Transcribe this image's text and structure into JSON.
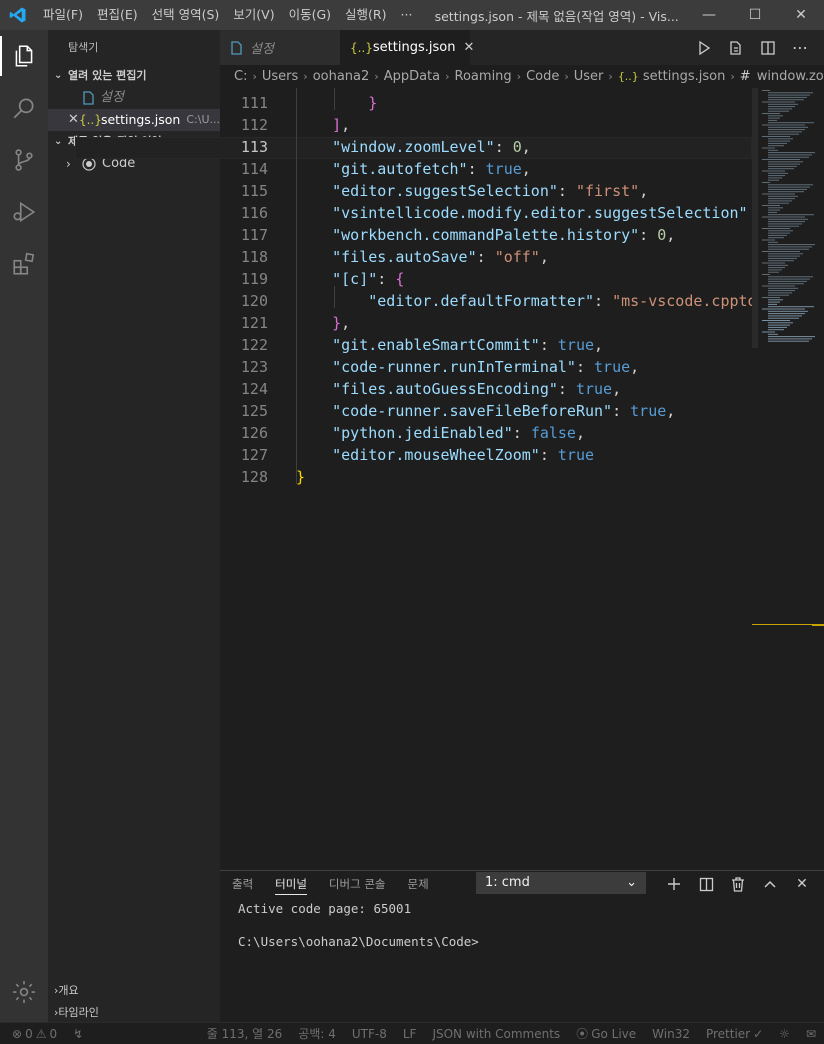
{
  "titlebar": {
    "menu": [
      "파일(F)",
      "편집(E)",
      "선택 영역(S)",
      "보기(V)",
      "이동(G)",
      "실행(R)",
      "···"
    ],
    "window_title": "settings.json - 제목 없음(작업 영역) - Vis..."
  },
  "sidebar": {
    "title": "탐색기",
    "open_editors_label": "열려 있는 편집기",
    "open_editors": [
      {
        "name": "설정",
        "icon": "file-icon"
      },
      {
        "name": "settings.json",
        "path": "C:\\U...",
        "icon": "json-braces-icon"
      }
    ],
    "workspace_label": "제목 없음(작업 영역)",
    "workspace_folder": "Code",
    "outline_label": "개요",
    "timeline_label": "타임라인"
  },
  "tabs": [
    {
      "label": "설정",
      "active": false
    },
    {
      "label": "settings.json",
      "active": true
    }
  ],
  "breadcrumb": [
    "C:",
    "Users",
    "oohana2",
    "AppData",
    "Roaming",
    "Code",
    "User",
    "settings.json",
    "window.zoomLev..."
  ],
  "editor": {
    "current_line": 113,
    "lines": [
      {
        "n": "111",
        "tokens": [
          {
            "t": "        ",
            "c": "p"
          },
          {
            "t": "}",
            "c": "bracket2"
          }
        ]
      },
      {
        "n": "112",
        "tokens": [
          {
            "t": "    ",
            "c": "p"
          },
          {
            "t": "]",
            "c": "bracket2"
          },
          {
            "t": ",",
            "c": "p"
          }
        ]
      },
      {
        "n": "113",
        "tokens": [
          {
            "t": "    ",
            "c": "p"
          },
          {
            "t": "\"window.zoomLevel\"",
            "c": "k"
          },
          {
            "t": ": ",
            "c": "p"
          },
          {
            "t": "0",
            "c": "n"
          },
          {
            "t": ",",
            "c": "p"
          }
        ]
      },
      {
        "n": "114",
        "tokens": [
          {
            "t": "    ",
            "c": "p"
          },
          {
            "t": "\"git.autofetch\"",
            "c": "k"
          },
          {
            "t": ": ",
            "c": "p"
          },
          {
            "t": "true",
            "c": "b"
          },
          {
            "t": ",",
            "c": "p"
          }
        ]
      },
      {
        "n": "115",
        "tokens": [
          {
            "t": "    ",
            "c": "p"
          },
          {
            "t": "\"editor.suggestSelection\"",
            "c": "k"
          },
          {
            "t": ": ",
            "c": "p"
          },
          {
            "t": "\"first\"",
            "c": "s"
          },
          {
            "t": ",",
            "c": "p"
          }
        ]
      },
      {
        "n": "116",
        "tokens": [
          {
            "t": "    ",
            "c": "p"
          },
          {
            "t": "\"vsintellicode.modify.editor.suggestSelection\"",
            "c": "k"
          }
        ]
      },
      {
        "n": "117",
        "tokens": [
          {
            "t": "    ",
            "c": "p"
          },
          {
            "t": "\"workbench.commandPalette.history\"",
            "c": "k"
          },
          {
            "t": ": ",
            "c": "p"
          },
          {
            "t": "0",
            "c": "n"
          },
          {
            "t": ",",
            "c": "p"
          }
        ]
      },
      {
        "n": "118",
        "tokens": [
          {
            "t": "    ",
            "c": "p"
          },
          {
            "t": "\"files.autoSave\"",
            "c": "k"
          },
          {
            "t": ": ",
            "c": "p"
          },
          {
            "t": "\"off\"",
            "c": "s"
          },
          {
            "t": ",",
            "c": "p"
          }
        ]
      },
      {
        "n": "119",
        "tokens": [
          {
            "t": "    ",
            "c": "p"
          },
          {
            "t": "\"[c]\"",
            "c": "k"
          },
          {
            "t": ": ",
            "c": "p"
          },
          {
            "t": "{",
            "c": "bracket2"
          }
        ]
      },
      {
        "n": "120",
        "tokens": [
          {
            "t": "        ",
            "c": "p"
          },
          {
            "t": "\"editor.defaultFormatter\"",
            "c": "k"
          },
          {
            "t": ": ",
            "c": "p"
          },
          {
            "t": "\"ms-vscode.cpptools\"",
            "c": "s"
          }
        ]
      },
      {
        "n": "121",
        "tokens": [
          {
            "t": "    ",
            "c": "p"
          },
          {
            "t": "}",
            "c": "bracket2"
          },
          {
            "t": ",",
            "c": "p"
          }
        ]
      },
      {
        "n": "122",
        "tokens": [
          {
            "t": "    ",
            "c": "p"
          },
          {
            "t": "\"git.enableSmartCommit\"",
            "c": "k"
          },
          {
            "t": ": ",
            "c": "p"
          },
          {
            "t": "true",
            "c": "b"
          },
          {
            "t": ",",
            "c": "p"
          }
        ]
      },
      {
        "n": "123",
        "tokens": [
          {
            "t": "    ",
            "c": "p"
          },
          {
            "t": "\"code-runner.runInTerminal\"",
            "c": "k"
          },
          {
            "t": ": ",
            "c": "p"
          },
          {
            "t": "true",
            "c": "b"
          },
          {
            "t": ",",
            "c": "p"
          }
        ]
      },
      {
        "n": "124",
        "tokens": [
          {
            "t": "    ",
            "c": "p"
          },
          {
            "t": "\"files.autoGuessEncoding\"",
            "c": "k"
          },
          {
            "t": ": ",
            "c": "p"
          },
          {
            "t": "true",
            "c": "b"
          },
          {
            "t": ",",
            "c": "p"
          }
        ]
      },
      {
        "n": "125",
        "tokens": [
          {
            "t": "    ",
            "c": "p"
          },
          {
            "t": "\"code-runner.saveFileBeforeRun\"",
            "c": "k"
          },
          {
            "t": ": ",
            "c": "p"
          },
          {
            "t": "true",
            "c": "b"
          },
          {
            "t": ",",
            "c": "p"
          }
        ]
      },
      {
        "n": "126",
        "tokens": [
          {
            "t": "    ",
            "c": "p"
          },
          {
            "t": "\"python.jediEnabled\"",
            "c": "k"
          },
          {
            "t": ": ",
            "c": "p"
          },
          {
            "t": "false",
            "c": "b"
          },
          {
            "t": ",",
            "c": "p"
          }
        ]
      },
      {
        "n": "127",
        "tokens": [
          {
            "t": "    ",
            "c": "p"
          },
          {
            "t": "\"editor.mouseWheelZoom\"",
            "c": "k"
          },
          {
            "t": ": ",
            "c": "p"
          },
          {
            "t": "true",
            "c": "b"
          }
        ]
      },
      {
        "n": "128",
        "tokens": [
          {
            "t": "}",
            "c": "brace"
          }
        ]
      }
    ]
  },
  "panel": {
    "tabs": [
      {
        "label": "출력",
        "active": false
      },
      {
        "label": "터미널",
        "active": true
      },
      {
        "label": "디버그 콘솔",
        "active": false
      },
      {
        "label": "문제",
        "active": false
      }
    ],
    "terminal_select": "1: cmd",
    "terminal_lines": [
      "Active code page: 65001",
      "",
      "C:\\Users\\oohana2\\Documents\\Code>"
    ]
  },
  "statusbar": {
    "errors": "0",
    "warnings": "0",
    "cursor": "줄 113, 열 26",
    "spaces": "공백: 4",
    "encoding": "UTF-8",
    "eol": "LF",
    "language": "JSON with Comments",
    "golive": "Go Live",
    "platform": "Win32",
    "prettier": "Prettier"
  },
  "colors": {
    "accent": "#007acc",
    "titlebar": "#3c3c3c",
    "activitybar": "#333333",
    "sidebar": "#252526",
    "editor": "#1e1e1e"
  }
}
